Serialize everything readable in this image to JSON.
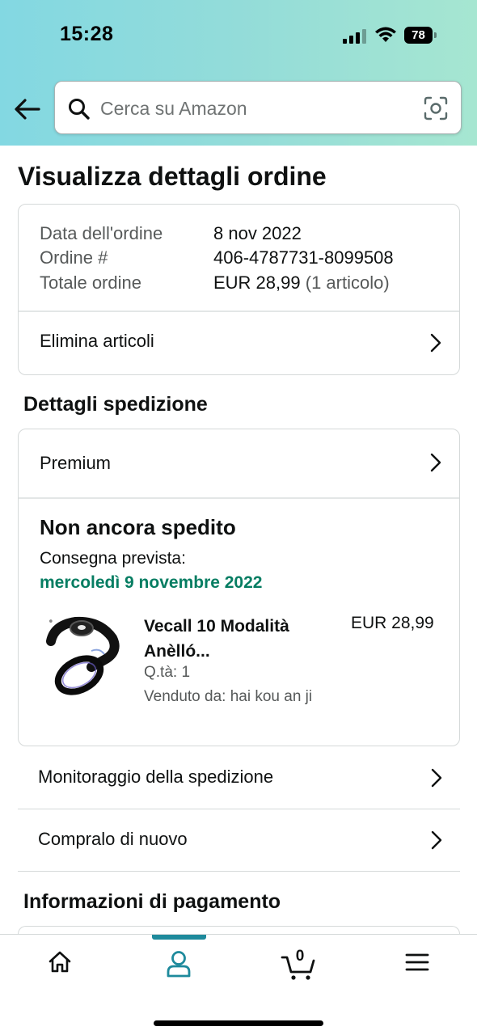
{
  "status_bar": {
    "time": "15:28",
    "battery": "78"
  },
  "search": {
    "placeholder": "Cerca su Amazon"
  },
  "page": {
    "title": "Visualizza dettagli ordine"
  },
  "order": {
    "date_label": "Data dell'ordine",
    "date_value": "8 nov 2022",
    "number_label": "Ordine #",
    "number_value": "406-4787731-8099508",
    "total_label": "Totale ordine",
    "total_value": "EUR 28,99",
    "total_items": "(1 articolo)",
    "delete_items_label": "Elimina articoli"
  },
  "shipping": {
    "section_title": "Dettagli spedizione",
    "method": "Premium",
    "status": "Non ancora spedito",
    "eta_label": "Consegna prevista:",
    "eta_date": "mercoledì 9 novembre 2022",
    "product": {
      "title_line1": "Vecall 10 Modalità",
      "title_line2": "Anèlló...",
      "price": "EUR 28,99",
      "qty": "Q.tà: 1",
      "seller": "Venduto da: hai kou an ji"
    }
  },
  "actions": {
    "track_label": "Monitoraggio della spedizione",
    "buy_again_label": "Compralo di nuovo"
  },
  "payment": {
    "section_title": "Informazioni di pagamento"
  },
  "tabbar": {
    "active_tab": "account",
    "cart_count": "0",
    "accent_color": "#1e8a9c"
  },
  "colors": {
    "eta_green": "#067d62",
    "header_gradient_start": "#83d8e2",
    "header_gradient_end": "#a6e6d1"
  }
}
